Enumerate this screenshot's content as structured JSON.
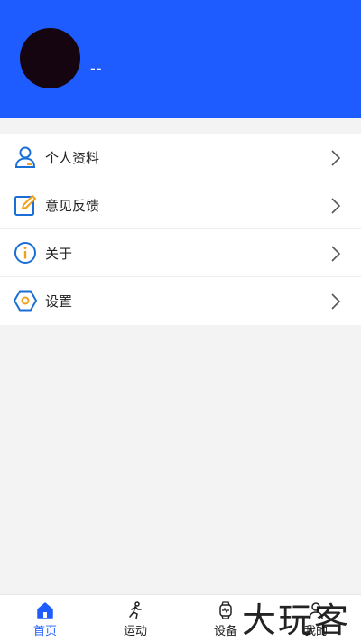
{
  "profile": {
    "username": "--"
  },
  "menu": {
    "items": [
      {
        "label": "个人资料",
        "icon": "user-icon"
      },
      {
        "label": "意见反馈",
        "icon": "edit-icon"
      },
      {
        "label": "关于",
        "icon": "info-icon"
      },
      {
        "label": "设置",
        "icon": "settings-icon"
      }
    ]
  },
  "tabbar": {
    "tabs": [
      {
        "label": "首页",
        "icon": "home-icon",
        "active": true
      },
      {
        "label": "运动",
        "icon": "running-icon",
        "active": false
      },
      {
        "label": "设备",
        "icon": "watch-icon",
        "active": false
      },
      {
        "label": "我的",
        "icon": "user-icon",
        "active": false
      }
    ]
  },
  "watermark": "大玩客",
  "colors": {
    "header": "#1f5cff",
    "accent": "#1f5cff",
    "icon_blue": "#1a6fd6",
    "icon_orange": "#f0a020"
  }
}
